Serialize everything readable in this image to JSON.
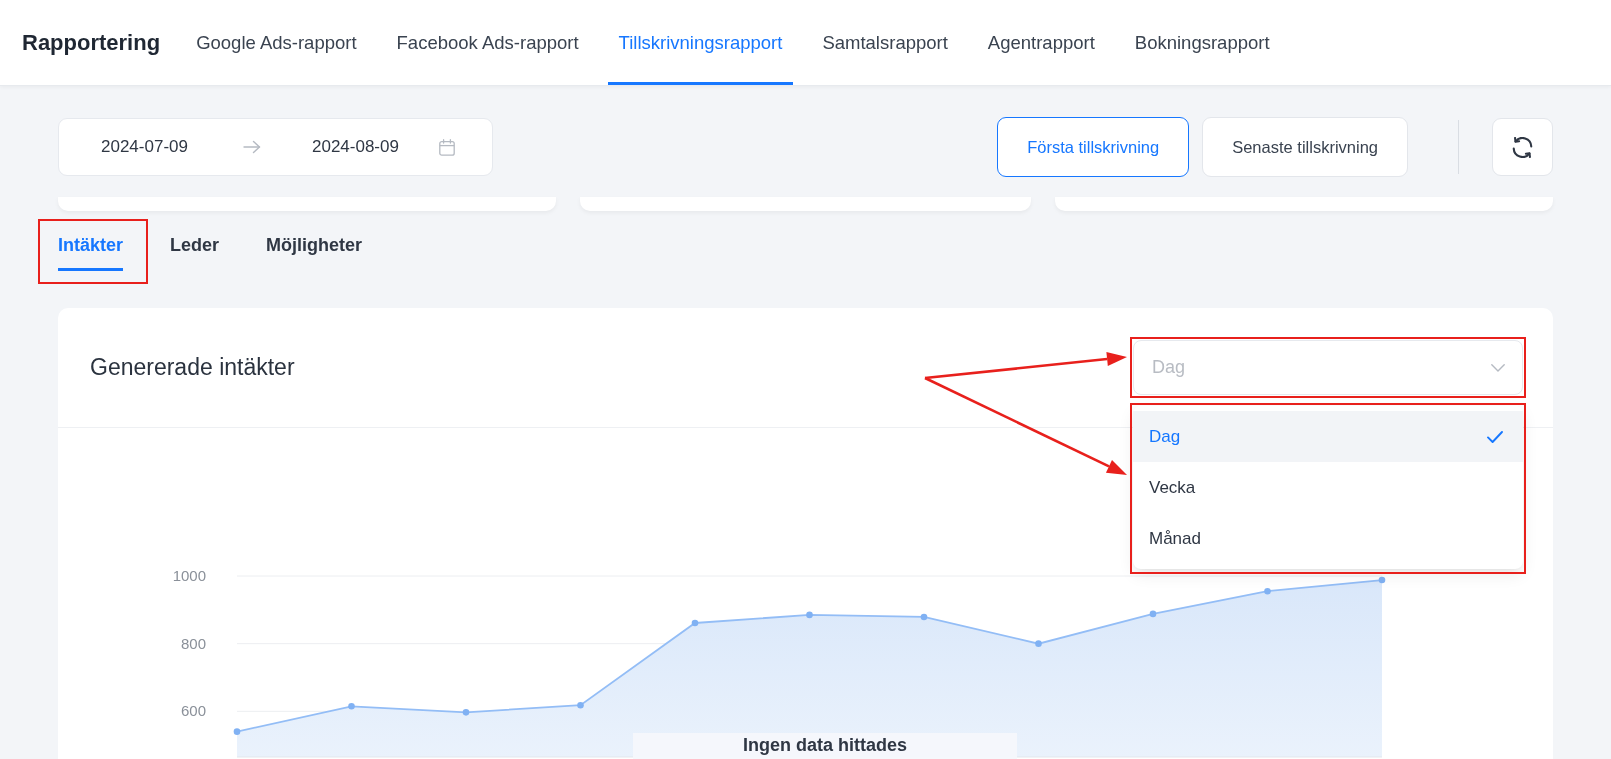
{
  "nav": {
    "brand": "Rapportering",
    "items": [
      {
        "label": "Google Ads-rapport",
        "selected": false
      },
      {
        "label": "Facebook Ads-rapport",
        "selected": false
      },
      {
        "label": "Tillskrivningsrapport",
        "selected": true
      },
      {
        "label": "Samtalsrapport",
        "selected": false
      },
      {
        "label": "Agentrapport",
        "selected": false
      },
      {
        "label": "Bokningsrapport",
        "selected": false
      }
    ]
  },
  "toolbar": {
    "date_range": {
      "start": "2024-07-09",
      "end": "2024-08-09"
    },
    "attribution": [
      {
        "label": "Första tillskrivning",
        "selected": true
      },
      {
        "label": "Senaste tillskrivning",
        "selected": false
      }
    ]
  },
  "tabs": [
    {
      "label": "Intäkter",
      "selected": true
    },
    {
      "label": "Leder",
      "selected": false
    },
    {
      "label": "Möjligheter",
      "selected": false
    }
  ],
  "revenue_card": {
    "title": "Genererade intäkter",
    "period_select": {
      "value": "Dag",
      "expanded": true,
      "options": [
        {
          "label": "Dag",
          "selected": true
        },
        {
          "label": "Vecka",
          "selected": false
        },
        {
          "label": "Månad",
          "selected": false
        }
      ]
    },
    "chart_data": {
      "type": "area",
      "categories": [
        null,
        null,
        null,
        null,
        null,
        null,
        null,
        null,
        null,
        null,
        null
      ],
      "ylim": [
        465,
        1000
      ],
      "yticks": [
        600,
        800,
        1000
      ],
      "grid": true,
      "values": [
        540,
        615,
        597,
        618,
        861,
        885,
        879,
        800,
        888,
        955,
        988
      ]
    },
    "empty_message": "Ingen data hittades"
  }
}
